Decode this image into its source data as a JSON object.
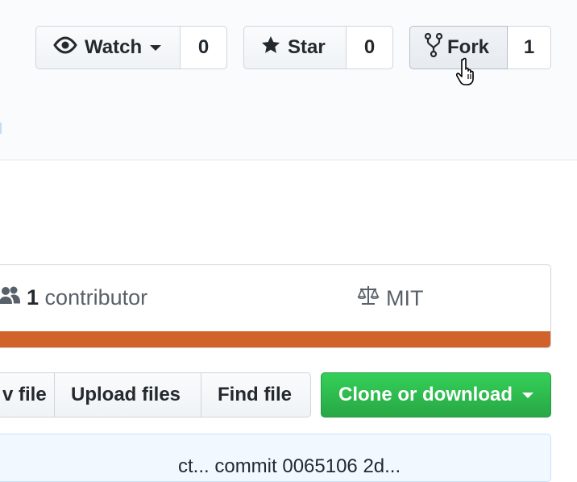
{
  "header": {
    "watch": {
      "label": "Watch",
      "count": "0"
    },
    "star": {
      "label": "Star",
      "count": "0"
    },
    "fork": {
      "label": "Fork",
      "count": "1"
    }
  },
  "summary": {
    "contributors_count": "1",
    "contributors_label": "contributor",
    "license": "MIT",
    "language_color": "#d0622a"
  },
  "file_actions": {
    "create_file_partial": "v file",
    "upload_files": "Upload files",
    "find_file": "Find file"
  },
  "clone": {
    "label": "Clone or download"
  },
  "commit": {
    "text_partial": "ct... commit 0065106 2d..."
  }
}
